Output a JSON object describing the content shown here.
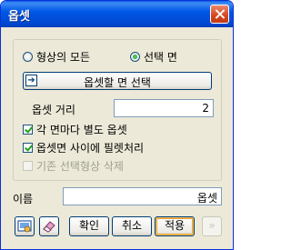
{
  "window": {
    "title": "옵셋"
  },
  "shape_mode": {
    "options": [
      {
        "label": "형상의 모든",
        "selected": false
      },
      {
        "label": "선택 면",
        "selected": true
      }
    ]
  },
  "select_face_button": {
    "label": "옵셋할 면 선택"
  },
  "offset_distance": {
    "label": "옵셋 거리",
    "value": "2"
  },
  "checkboxes": [
    {
      "label": "각 면마다 별도 옵셋",
      "checked": true,
      "enabled": true
    },
    {
      "label": "옵셋면 사이에 필렛처리",
      "checked": true,
      "enabled": true
    },
    {
      "label": "기존 선택형상 삭제",
      "checked": false,
      "enabled": false
    }
  ],
  "name_field": {
    "label": "이름",
    "value": "옵셋"
  },
  "buttons": {
    "ok": "확인",
    "cancel": "취소",
    "apply": "적용",
    "more": "»"
  },
  "icons": {
    "preview": "preview-icon",
    "eraser": "eraser-icon",
    "select": "face-select-icon"
  }
}
